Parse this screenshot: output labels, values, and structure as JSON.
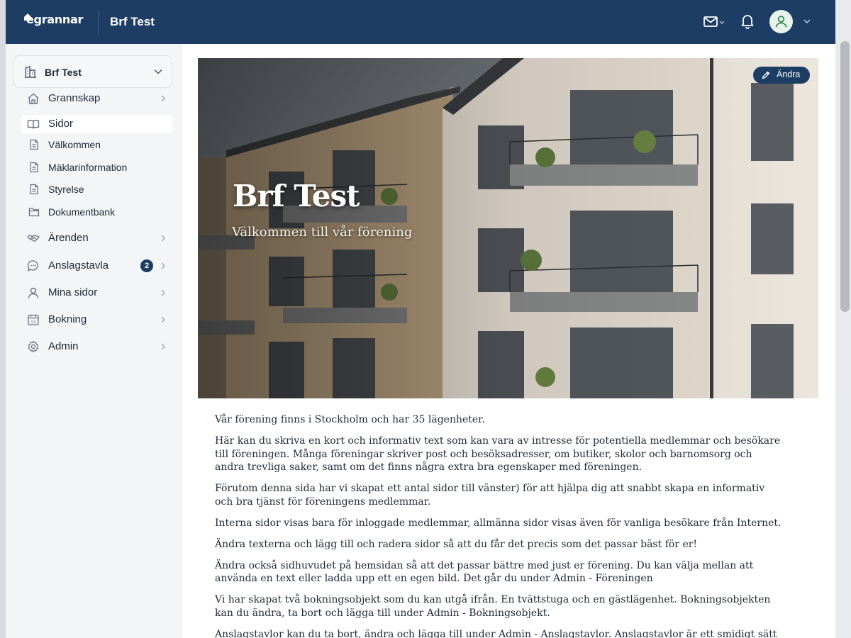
{
  "header": {
    "logo_text": "egrannar",
    "association_title": "Brf Test",
    "icons": [
      "mail-icon",
      "bell-icon",
      "user-icon"
    ],
    "colors": {
      "topbar": "#1d3d64",
      "accent": "#1d3d64",
      "avatar_bg": "#e6f3ea"
    }
  },
  "sidebar": {
    "association_selector": "Brf Test",
    "items": [
      {
        "label": "Grannskap",
        "icon": "home-icon"
      },
      {
        "label": "Sidor",
        "icon": "book-icon",
        "active": true
      },
      {
        "label": "Ärenden",
        "icon": "handshake-icon"
      },
      {
        "label": "Anslagstavla",
        "icon": "chat-icon",
        "badge": "2"
      },
      {
        "label": "Mina sidor",
        "icon": "user-icon"
      },
      {
        "label": "Bokning",
        "icon": "calendar-icon"
      },
      {
        "label": "Admin",
        "icon": "gear-icon"
      }
    ],
    "sub_items": [
      {
        "label": "Välkommen",
        "icon": "document-icon"
      },
      {
        "label": "Mäklarinformation",
        "icon": "document-icon"
      },
      {
        "label": "Styrelse",
        "icon": "document-icon"
      },
      {
        "label": "Dokumentbank",
        "icon": "folder-icon"
      }
    ]
  },
  "hero": {
    "title": "Brf Test",
    "subtitle": "Välkommen till vår förening",
    "edit_label": "Ändra"
  },
  "content": {
    "paragraphs": [
      "Vår förening finns i Stockholm och har 35 lägenheter.",
      "Här kan du skriva en kort och informativ text som kan vara av intresse för potentiella medlemmar och besökare till föreningen. Många föreningar skriver post och besöksadresser, om butiker, skolor och barnomsorg och andra trevliga saker, samt om det finns några extra bra egenskaper med föreningen.",
      "Förutom denna sida har vi skapat ett antal sidor till vänster) för att hjälpa dig att snabbt skapa en informativ och bra tjänst för föreningens medlemmar.",
      "Interna sidor visas bara för inloggade medlemmar, allmänna sidor visas även för vanliga besökare från Internet.",
      "Ändra texterna och lägg till och radera sidor så att du får det precis som det passar bäst för er!",
      "Ändra också sidhuvudet på hemsidan så att det passar bättre med just er förening. Du kan välja mellan att använda en text eller ladda upp ett en egen bild. Det går du under Admin - Föreningen",
      "Vi har skapat två bokningsobjekt som du kan utgå ifrån. En tvättstuga och en gästlägenhet. Bokningsobjekten kan du ändra, ta bort och lägga till under Admin - Bokningsobjekt.",
      "Anslagstavlor kan du ta bort, ändra och lägga till under Admin - Anslagstavlor. Anslagstavlor är ett smidigt sätt för"
    ]
  }
}
